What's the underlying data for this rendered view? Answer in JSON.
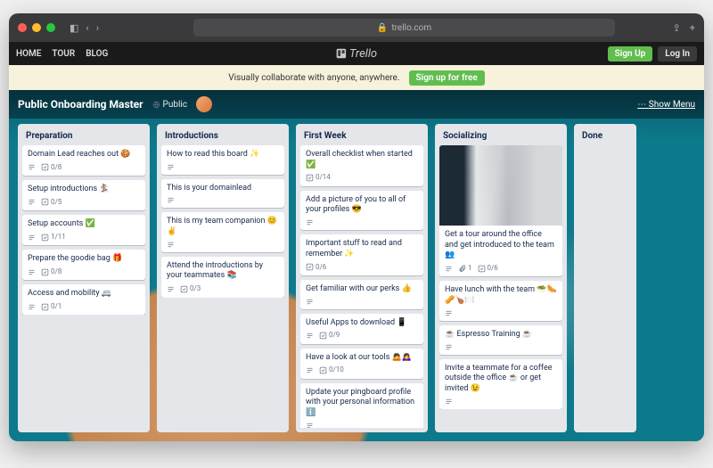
{
  "browser": {
    "url": "trello.com"
  },
  "nav": {
    "home": "HOME",
    "tour": "TOUR",
    "blog": "BLOG",
    "brand": "Trello",
    "signup": "Sign Up",
    "login": "Log In"
  },
  "promo": {
    "text": "Visually collaborate with anyone, anywhere.",
    "cta": "Sign up for free"
  },
  "board": {
    "title": "Public Onboarding Master",
    "visibility": "Public",
    "show_menu": "Show Menu"
  },
  "lists": [
    {
      "title": "Preparation",
      "cards": [
        {
          "title": "Domain Lead reaches out 🍪",
          "desc": true,
          "check": "0/8"
        },
        {
          "title": "Setup introductions 🏂",
          "desc": true,
          "check": "0/5"
        },
        {
          "title": "Setup accounts ✅",
          "desc": true,
          "check": "1/11"
        },
        {
          "title": "Prepare the goodie bag 🎁",
          "desc": true,
          "check": "0/8"
        },
        {
          "title": "Access and mobility 🚐",
          "desc": true,
          "check": "0/1"
        }
      ]
    },
    {
      "title": "Introductions",
      "cards": [
        {
          "title": "How to read this board ✨",
          "desc": true
        },
        {
          "title": "This is your domainlead",
          "desc": true
        },
        {
          "title": "This is my team companion 😊✌️",
          "desc": true
        },
        {
          "title": "Attend the introductions by your teammates 📚",
          "desc": true,
          "check": "0/3"
        }
      ]
    },
    {
      "title": "First Week",
      "cards": [
        {
          "title": "Overall checklist when started ✅",
          "check": "0/14"
        },
        {
          "title": "Add a picture of you to all of your profiles 😎",
          "desc": true
        },
        {
          "title": "Important stuff to read and remember ✨",
          "check": "0/6"
        },
        {
          "title": "Get familiar with our perks 👍",
          "desc": true
        },
        {
          "title": "Useful Apps to download 📱",
          "desc": true,
          "check": "0/9"
        },
        {
          "title": "Have a look at our tools 🙇🙇‍♀️",
          "desc": true,
          "check": "0/10"
        },
        {
          "title": "Update your pingboard profile with your personal information ℹ️",
          "desc": true
        }
      ]
    },
    {
      "title": "Socializing",
      "cards": [
        {
          "image": true,
          "title": "Get a tour around the office and get introduced to the team 👥",
          "desc": true,
          "attach": "1",
          "check": "0/6"
        },
        {
          "title": "Have lunch with the team 🥗🌭🥜🍗🍽️",
          "desc": true
        },
        {
          "title": "☕ Espresso Training ☕",
          "desc": true
        },
        {
          "title": "Invite a teammate for a coffee outside the office ☕ or get invited 😉",
          "desc": true
        }
      ]
    },
    {
      "title": "Done",
      "cards": [],
      "small": true
    }
  ]
}
